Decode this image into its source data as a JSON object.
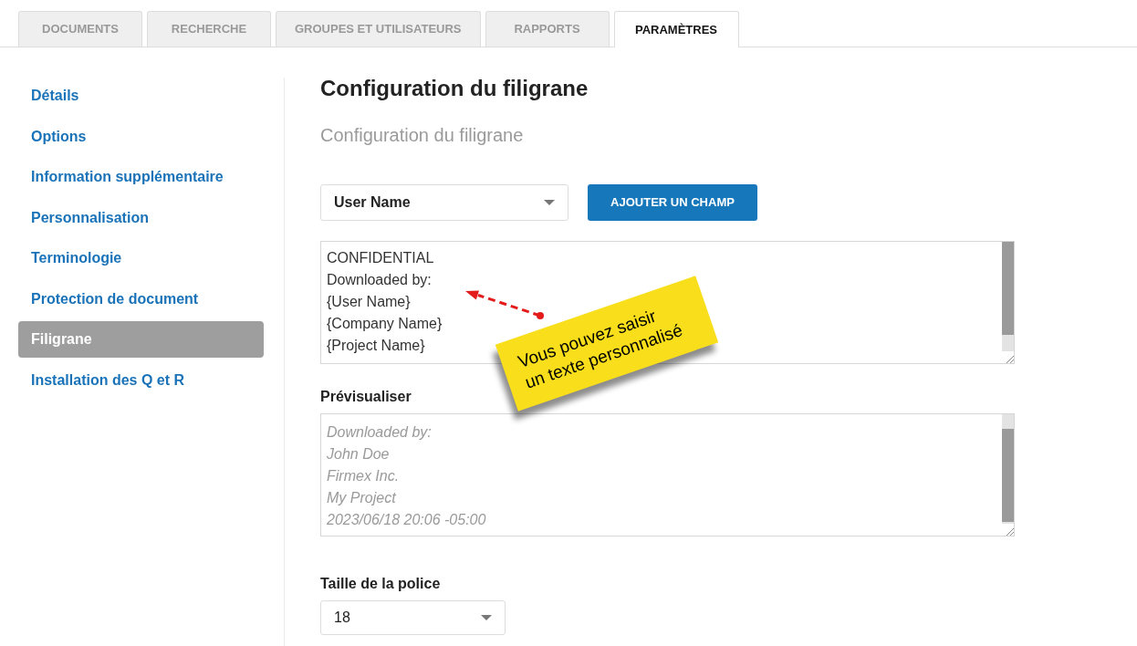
{
  "tabs": [
    {
      "label": "DOCUMENTS",
      "selected": false
    },
    {
      "label": "RECHERCHE",
      "selected": false
    },
    {
      "label": "GROUPES ET UTILISATEURS",
      "selected": false
    },
    {
      "label": "RAPPORTS",
      "selected": false
    },
    {
      "label": "PARAMÈTRES",
      "selected": true
    }
  ],
  "sidebar": {
    "items": [
      {
        "label": "Détails",
        "selected": false
      },
      {
        "label": "Options",
        "selected": false
      },
      {
        "label": "Information supplémentaire",
        "selected": false
      },
      {
        "label": "Personnalisation",
        "selected": false
      },
      {
        "label": "Terminologie",
        "selected": false
      },
      {
        "label": "Protection de document",
        "selected": false
      },
      {
        "label": "Filigrane",
        "selected": true
      },
      {
        "label": "Installation des Q et R",
        "selected": false
      }
    ]
  },
  "content": {
    "title": "Configuration du filigrane",
    "subtitle": "Configuration du filigrane",
    "field_select": {
      "value": "User Name"
    },
    "add_button": "AJOUTER UN CHAMP",
    "watermark_text": {
      "lines": [
        "CONFIDENTIAL",
        "Downloaded by:",
        "{User Name}",
        "{Company Name}",
        "{Project Name}"
      ]
    },
    "preview": {
      "label": "Prévisualiser",
      "lines": [
        "Downloaded by:",
        "John Doe",
        "Firmex Inc.",
        "My Project",
        "2023/06/18 20:06 -05:00"
      ]
    },
    "font_size": {
      "label": "Taille de la police",
      "value": "18"
    }
  },
  "callout": {
    "text": "Vous pouvez saisir\nun texte personnalisé"
  }
}
